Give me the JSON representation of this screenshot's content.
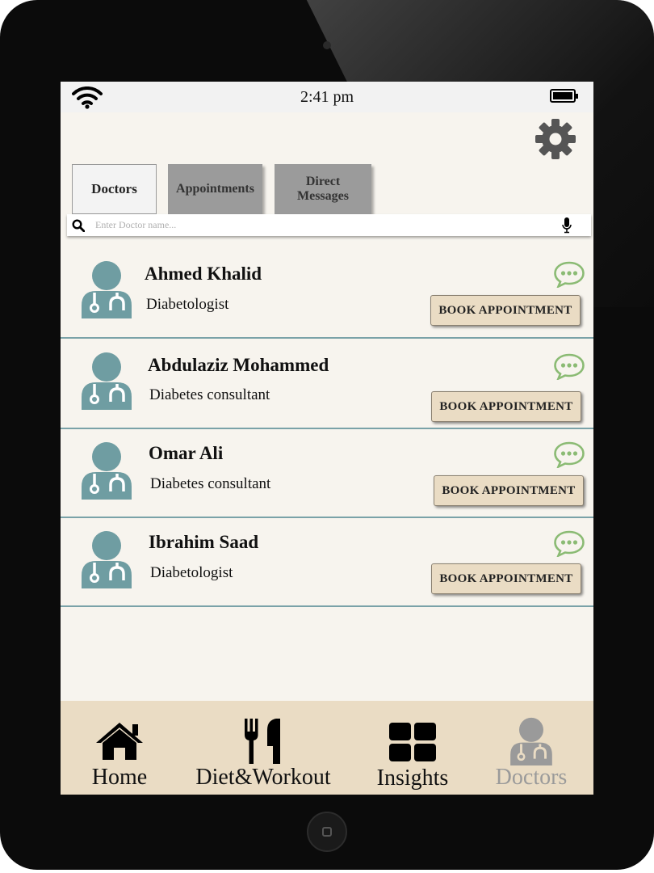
{
  "status_bar": {
    "time": "2:41 pm"
  },
  "tabs": [
    {
      "label": "Doctors",
      "active": true
    },
    {
      "label": "Appointments",
      "active": false
    },
    {
      "label_line1": "Direct",
      "label_line2": "Messages",
      "active": false
    }
  ],
  "search": {
    "placeholder": "Enter Doctor name...",
    "value": ""
  },
  "doctors": [
    {
      "name": "Ahmed Khalid",
      "specialty": "Diabetologist",
      "button": "BOOK APPOINTMENT"
    },
    {
      "name": "Abdulaziz Mohammed",
      "specialty": "Diabetes consultant",
      "button": "BOOK APPOINTMENT"
    },
    {
      "name": "Omar Ali",
      "specialty": "Diabetes consultant",
      "button": "BOOK APPOINTMENT"
    },
    {
      "name": "Ibrahim Saad",
      "specialty": "Diabetologist",
      "button": "BOOK APPOINTMENT"
    }
  ],
  "bottom_nav": [
    {
      "label": "Home",
      "icon": "home-icon",
      "active": false
    },
    {
      "label": "Diet&Workout",
      "icon": "fork-knife-icon",
      "active": false
    },
    {
      "label": "Insights",
      "icon": "grid-icon",
      "active": false
    },
    {
      "label": "Doctors",
      "icon": "doctor-icon",
      "active": true
    }
  ],
  "colors": {
    "screen_bg": "#f7f4ee",
    "nav_bg": "#eadcc4",
    "button_bg": "#eadcc4",
    "avatar": "#6f9da2",
    "chat_icon": "#8bbb74",
    "divider": "#7aa2a8",
    "inactive_tab": "#9b9b9b"
  }
}
